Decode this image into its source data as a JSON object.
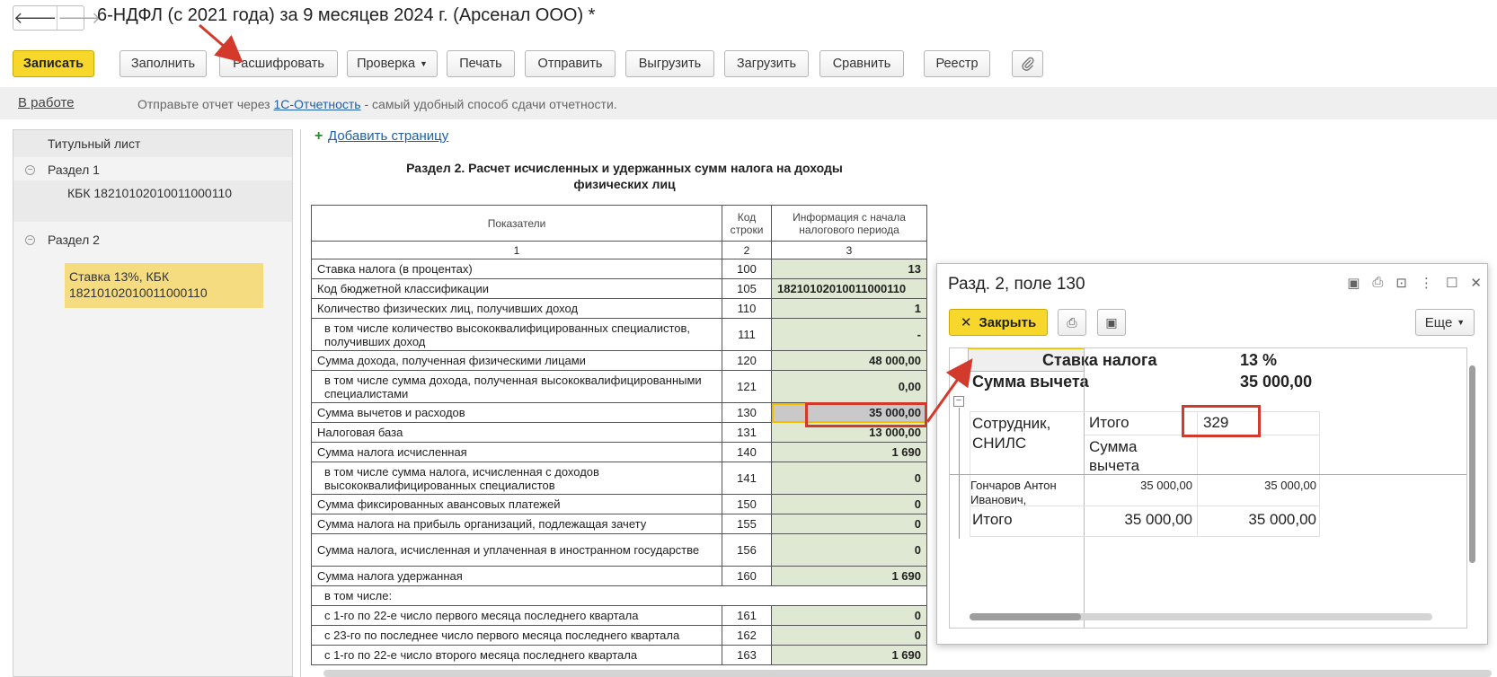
{
  "window": {
    "title": "6-НДФЛ (с 2021 года) за 9 месяцев 2024 г. (Арсенал ООО) *",
    "nav_back": "🡐",
    "nav_forward": "🡒"
  },
  "toolbar": {
    "save": "Записать",
    "fill": "Заполнить",
    "decode": "Расшифровать",
    "check": "Проверка",
    "print": "Печать",
    "send": "Отправить",
    "export": "Выгрузить",
    "import": "Загрузить",
    "compare": "Сравнить",
    "registry": "Реестр",
    "attach_icon": "paperclip-icon"
  },
  "status": {
    "state": "В работе",
    "msg_prefix": "Отправьте отчет через ",
    "msg_link": "1С-Отчетность",
    "msg_suffix": " - самый удобный способ сдачи отчетности."
  },
  "tree": {
    "title_page": "Титульный лист",
    "section1": "Раздел 1",
    "kbk1": "КБК 18210102010011000110",
    "section2": "Раздел 2",
    "selected": "Ставка 13%, КБК 18210102010011000110"
  },
  "main": {
    "add_page": "Добавить страницу",
    "section_title": "Раздел 2. Расчет исчисленных и удержанных сумм налога на доходы физических лиц",
    "headers": [
      "Показатели",
      "Код строки",
      "Информация с начала налогового периода"
    ],
    "col_nums": [
      "1",
      "2",
      "3"
    ],
    "rows": [
      {
        "label": "Ставка налога (в процентах)",
        "code": "100",
        "value": "13"
      },
      {
        "label": "Код бюджетной классификации",
        "code": "105",
        "value": "18210102010011000110"
      },
      {
        "label": "Количество физических лиц, получивших доход",
        "code": "110",
        "value": "1"
      },
      {
        "label": "в том числе количество высококвалифицированных специалистов, получивших доход",
        "code": "111",
        "value": "-"
      },
      {
        "label": "Сумма дохода, полученная физическими лицами",
        "code": "120",
        "value": "48 000,00"
      },
      {
        "label": "в том числе сумма дохода, полученная высококвалифицированными специалистами",
        "code": "121",
        "value": "0,00"
      },
      {
        "label": "Сумма вычетов и расходов",
        "code": "130",
        "value": "35 000,00"
      },
      {
        "label": "Налоговая база",
        "code": "131",
        "value": "13 000,00"
      },
      {
        "label": "Сумма налога исчисленная",
        "code": "140",
        "value": "1 690"
      },
      {
        "label": "в том числе сумма налога, исчисленная с доходов высококвалифицированных специалистов",
        "code": "141",
        "value": "0"
      },
      {
        "label": "Сумма фиксированных авансовых платежей",
        "code": "150",
        "value": "0"
      },
      {
        "label": "Сумма налога на прибыль организаций, подлежащая зачету",
        "code": "155",
        "value": "0"
      },
      {
        "label": "Сумма налога, исчисленная и уплаченная в иностранном государстве",
        "code": "156",
        "value": "0"
      },
      {
        "label": "Сумма налога удержанная",
        "code": "160",
        "value": "1 690"
      },
      {
        "label": "в том числе:",
        "code": "",
        "value": ""
      },
      {
        "label": "с 1-го по 22-е число первого месяца последнего квартала",
        "code": "161",
        "value": "0"
      },
      {
        "label": "с 23-го по последнее число первого месяца последнего квартала",
        "code": "162",
        "value": "0"
      },
      {
        "label": "с 1-го по 22-е число второго месяца последнего квартала",
        "code": "163",
        "value": "1 690"
      }
    ]
  },
  "popup": {
    "title": "Разд. 2, поле 130",
    "close": "Закрыть",
    "more": "Еще",
    "rate_label": "Ставка налога",
    "rate_value": "13 %",
    "deduct_label": "Сумма вычета",
    "deduct_value": "35 000,00",
    "col_employee": "Сотрудник, СНИЛС",
    "col_total": "Итого",
    "col_code": "329",
    "col_deduct": "Сумма вычета",
    "employee_name": "Гончаров Антон Иванович,",
    "employee_total": "35 000,00",
    "employee_code_value": "35 000,00",
    "total_label": "Итого",
    "total_sum": "35 000,00",
    "total_code_value": "35 000,00"
  },
  "colors": {
    "accent_yellow": "#f7d72c",
    "tree_selected": "#f5dc80",
    "cell_green": "#dfe8d2",
    "annotation_red": "#d33a2c",
    "link_blue": "#1f5fa8"
  }
}
